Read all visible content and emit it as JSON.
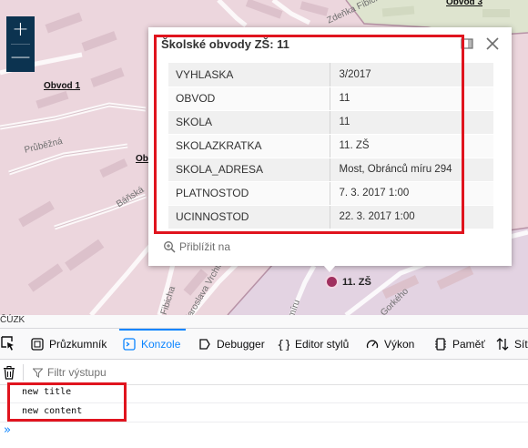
{
  "map": {
    "district_labels": [
      "Obvod 1",
      "Obvod 3",
      "Obv"
    ],
    "street_labels": [
      "Průběžná",
      "Báňská",
      "Fibicha",
      "Jaroslava Vrchlického",
      "míru",
      "Gorkého",
      "Zdeňka Fibicha"
    ],
    "zoom_in_label": "+",
    "zoom_out_label": "—",
    "attribution": "ČÚZK",
    "poi_label": "11. ZŠ",
    "colors": {
      "map_bg": "#ecd6dd",
      "map_green": "#dee4cf",
      "map_purple": "#e3d3e2",
      "zoom_bg": "#0c3350",
      "highlight": "#e0141e",
      "poi": "#a0305f"
    }
  },
  "popup": {
    "title": "Školské obvody ZŠ: 11",
    "rows": [
      {
        "key": "VYHLASKA",
        "value": "3/2017"
      },
      {
        "key": "OBVOD",
        "value": "11"
      },
      {
        "key": "SKOLA",
        "value": "11"
      },
      {
        "key": "SKOLAZKRATKA",
        "value": "11. ZŠ"
      },
      {
        "key": "SKOLA_ADRESA",
        "value": "Most, Obránců míru 294"
      },
      {
        "key": "PLATNOSTOD",
        "value": "7. 3. 2017 1:00"
      },
      {
        "key": "UCINNOSTOD",
        "value": "22. 3. 2017 1:00"
      }
    ],
    "zoom_to_label": "Přiblížit na",
    "icons": {
      "dock": "dock-icon",
      "close": "close-icon",
      "zoom_to": "zoom-in-magnifier-icon"
    }
  },
  "devtools": {
    "tabs": [
      {
        "label": "Průzkumník",
        "icon": "inspector-icon"
      },
      {
        "label": "Konzole",
        "icon": "console-icon",
        "active": true
      },
      {
        "label": "Debugger",
        "icon": "debugger-icon"
      },
      {
        "label": "Editor stylů",
        "icon": "style-editor-icon"
      },
      {
        "label": "Výkon",
        "icon": "performance-icon"
      },
      {
        "label": "Paměť",
        "icon": "memory-icon"
      },
      {
        "label": "Sít",
        "icon": "network-icon"
      }
    ],
    "filter_placeholder": "Filtr výstupu",
    "console_lines": [
      "new title",
      "new content"
    ],
    "prompt": "»"
  }
}
